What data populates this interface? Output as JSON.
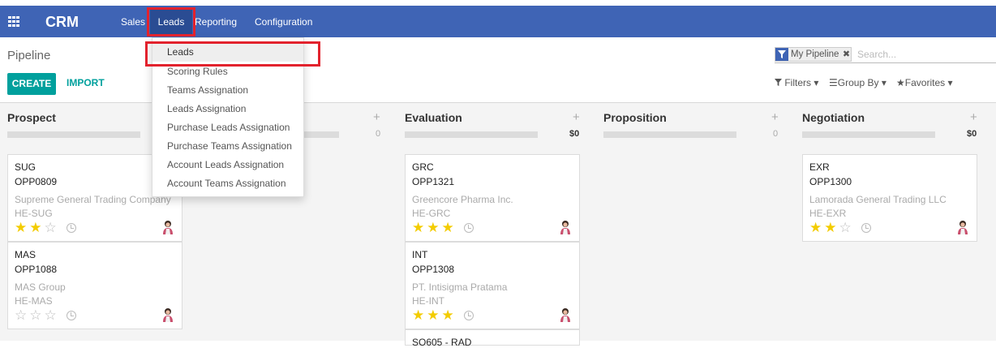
{
  "navbar": {
    "brand": "CRM",
    "menu": [
      "Sales",
      "Leads",
      "Reporting",
      "Configuration"
    ]
  },
  "breadcrumb": "Pipeline",
  "buttons": {
    "create": "CREATE",
    "import": "IMPORT"
  },
  "search": {
    "facet": "My Pipeline",
    "placeholder": "Search...",
    "filters": "Filters",
    "group_by": "Group By",
    "favorites": "Favorites"
  },
  "dropdown": {
    "items": [
      "Leads",
      "Scoring Rules",
      "Teams Assignation",
      "Leads Assignation",
      "Purchase Leads Assignation",
      "Purchase Teams Assignation",
      "Account Leads Assignation",
      "Account Teams Assignation"
    ]
  },
  "columns": [
    {
      "title": "Prospect",
      "sum": "",
      "cards": [
        {
          "code": "SUG",
          "ref": "OPP0809",
          "partner": "Supreme General Trading Company",
          "tag": "HE-SUG",
          "stars": 2
        },
        {
          "code": "MAS",
          "ref": "OPP1088",
          "partner": "MAS Group",
          "tag": "HE-MAS",
          "stars": 0
        }
      ]
    },
    {
      "title": "",
      "sum": "0",
      "cards": []
    },
    {
      "title": "Evaluation",
      "sum": "$0",
      "cards": [
        {
          "code": "GRC",
          "ref": "OPP1321",
          "partner": "Greencore Pharma Inc.",
          "tag": "HE-GRC",
          "stars": 3
        },
        {
          "code": "INT",
          "ref": "OPP1308",
          "partner": "PT. Intisigma Pratama",
          "tag": "HE-INT",
          "stars": 3
        }
      ]
    },
    {
      "title": "Proposition",
      "sum": "0",
      "cards": []
    },
    {
      "title": "Negotiation",
      "sum": "$0",
      "cards": [
        {
          "code": "EXR",
          "ref": "OPP1300",
          "partner": "Lamorada General Trading LLC",
          "tag": "HE-EXR",
          "stars": 2
        }
      ]
    }
  ],
  "partial_card_text": "SO605 - RAD",
  "colors": {
    "navbar": "#3f64b5",
    "accent": "#00a09d",
    "highlight": "#e2222d",
    "star": "#f3cc00"
  }
}
